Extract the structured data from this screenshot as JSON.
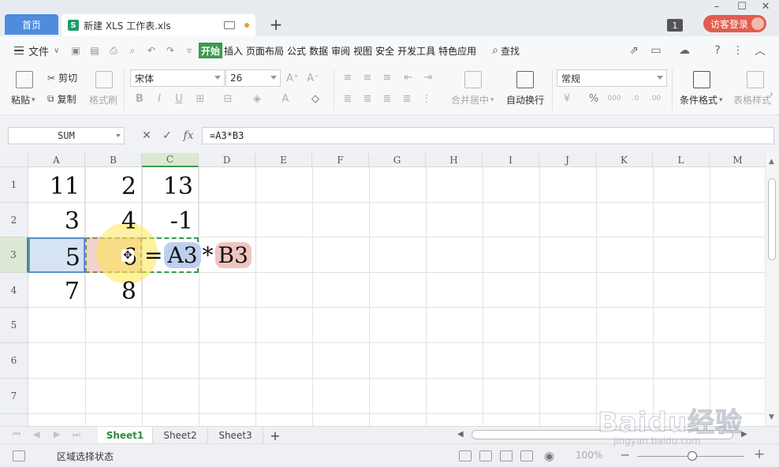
{
  "titlebar": {
    "home_tab": "首页",
    "file_tab_icon": "S",
    "file_tab": "新建 XLS 工作表.xls",
    "new_tab": "+",
    "window_count": "1",
    "login": "访客登录"
  },
  "menu": {
    "file": "文件",
    "tabs": [
      "开始",
      "插入",
      "页面布局",
      "公式",
      "数据",
      "审阅",
      "视图",
      "安全",
      "开发工具",
      "特色应用"
    ],
    "active_tab": "开始",
    "search": "查找"
  },
  "ribbon": {
    "paste": "粘贴",
    "cut": "剪切",
    "copy": "复制",
    "format_painter": "格式刷",
    "font_name": "宋体",
    "font_size": "26",
    "merge_center": "合并居中",
    "wrap_text": "自动换行",
    "number_format": "常规",
    "conditional_format": "条件格式",
    "table_style": "表格样式"
  },
  "formula_bar": {
    "name_box": "SUM",
    "fx": "fx",
    "formula": "=A3*B3"
  },
  "grid": {
    "columns": [
      "A",
      "B",
      "C",
      "D",
      "E",
      "F",
      "G",
      "H",
      "I",
      "J",
      "K",
      "L",
      "M"
    ],
    "rows": [
      "1",
      "2",
      "3",
      "4",
      "5",
      "6",
      "7"
    ],
    "selected_column": "C",
    "selected_row": "3",
    "cells": [
      [
        "11",
        "2",
        "13"
      ],
      [
        "3",
        "4",
        "-1"
      ],
      [
        "5",
        "6",
        ""
      ],
      [
        "7",
        "8",
        ""
      ]
    ],
    "editing_cell": {
      "eq": "=",
      "ref1": "A3",
      "op": "*",
      "ref2": "B3"
    },
    "ref_colors": {
      "A3": "#bcd0ee",
      "B3": "#efc5c0"
    }
  },
  "sheets": {
    "tabs": [
      "Sheet1",
      "Sheet2",
      "Sheet3"
    ],
    "active": "Sheet1",
    "add": "+"
  },
  "status": {
    "mode": "区域选择状态",
    "zoom": "100%"
  },
  "watermark": {
    "main": "Baidu经验",
    "sub": "jingyan.baidu.com"
  }
}
